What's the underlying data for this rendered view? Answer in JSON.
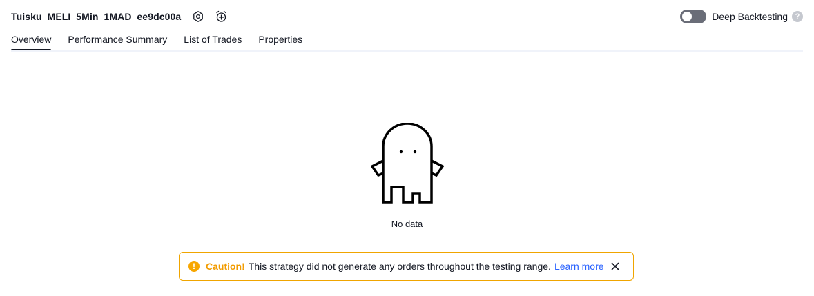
{
  "header": {
    "strategy_name": "Tuisku_MELI_5Min_1MAD_ee9dc00a",
    "icons": [
      "settings-icon",
      "add-alert-icon"
    ],
    "deep_backtesting": {
      "label": "Deep Backtesting",
      "enabled": false,
      "help_glyph": "?"
    }
  },
  "tabs": [
    {
      "label": "Overview",
      "active": true
    },
    {
      "label": "Performance Summary",
      "active": false
    },
    {
      "label": "List of Trades",
      "active": false
    },
    {
      "label": "Properties",
      "active": false
    }
  ],
  "empty_state": {
    "icon": "ghost-icon",
    "message": "No data"
  },
  "caution": {
    "icon_glyph": "!",
    "title": "Caution!",
    "message": "This strategy did not generate any orders throughout the testing range.",
    "link_label": "Learn more",
    "colors": {
      "border": "#f0a500",
      "title": "#f29c00",
      "link": "#2962ff"
    }
  }
}
